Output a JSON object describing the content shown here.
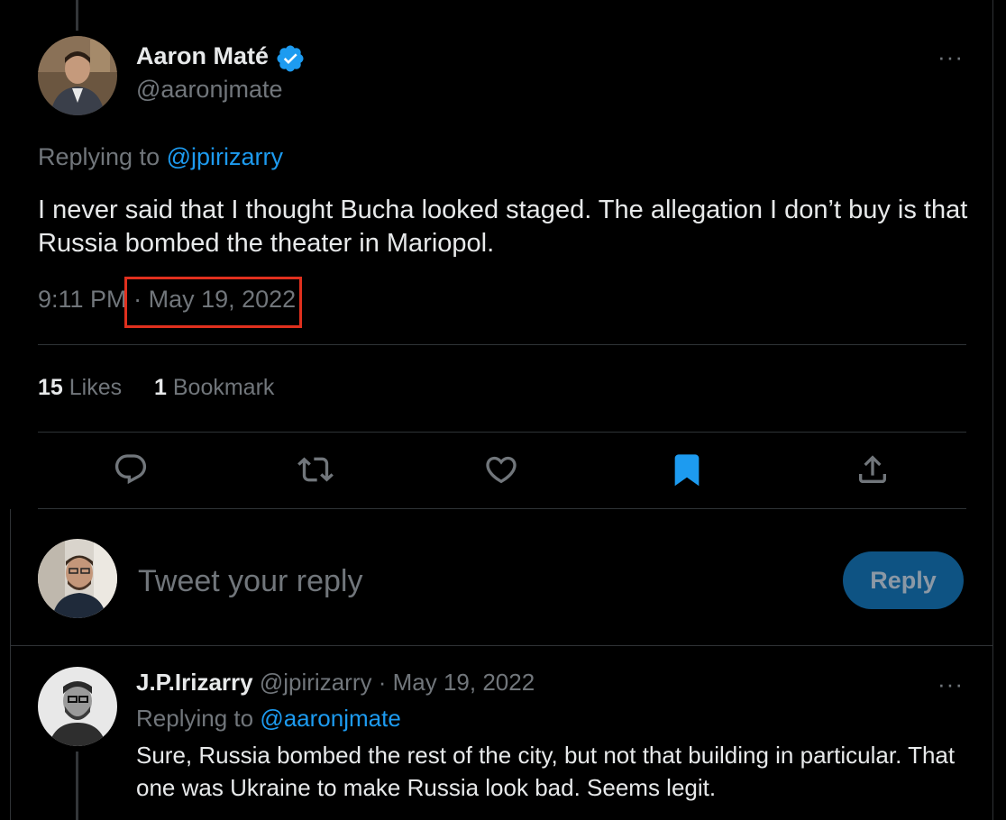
{
  "main_tweet": {
    "author_name": "Aaron Maté",
    "author_handle": "@aaronjmate",
    "replying_label": "Replying to",
    "replying_to": "@jpirizarry",
    "text": "I never said that I thought Bucha looked staged. The allegation I don’t buy is that Russia bombed the theater in Mariopol.",
    "time": "9:11 PM",
    "separator": "·",
    "date": "May 19, 2022",
    "likes_count": "15",
    "likes_label": "Likes",
    "bookmarks_count": "1",
    "bookmarks_label": "Bookmark",
    "more_label": "···"
  },
  "actions": {
    "reply_icon": "comment-icon",
    "retweet_icon": "retweet-icon",
    "like_icon": "heart-icon",
    "bookmark_icon": "bookmark-icon",
    "share_icon": "share-icon"
  },
  "composer": {
    "placeholder": "Tweet your reply",
    "button_label": "Reply"
  },
  "reply_tweet": {
    "author_name": "J.P.Irizarry",
    "author_handle": "@jpirizarry",
    "separator": "·",
    "date": "May 19, 2022",
    "replying_label": "Replying to",
    "replying_to": "@aaronjmate",
    "text": "Sure, Russia bombed the rest of the city, but not that building in particular. That one was Ukraine to make Russia look bad. Seems legit.",
    "more_label": "···"
  },
  "colors": {
    "background": "#000000",
    "text": "#e7e9ea",
    "muted": "#71767b",
    "link": "#1d9bf0",
    "bookmark_active": "#1d9bf0",
    "highlight": "#e0301e",
    "reply_button": "#0e5383"
  }
}
